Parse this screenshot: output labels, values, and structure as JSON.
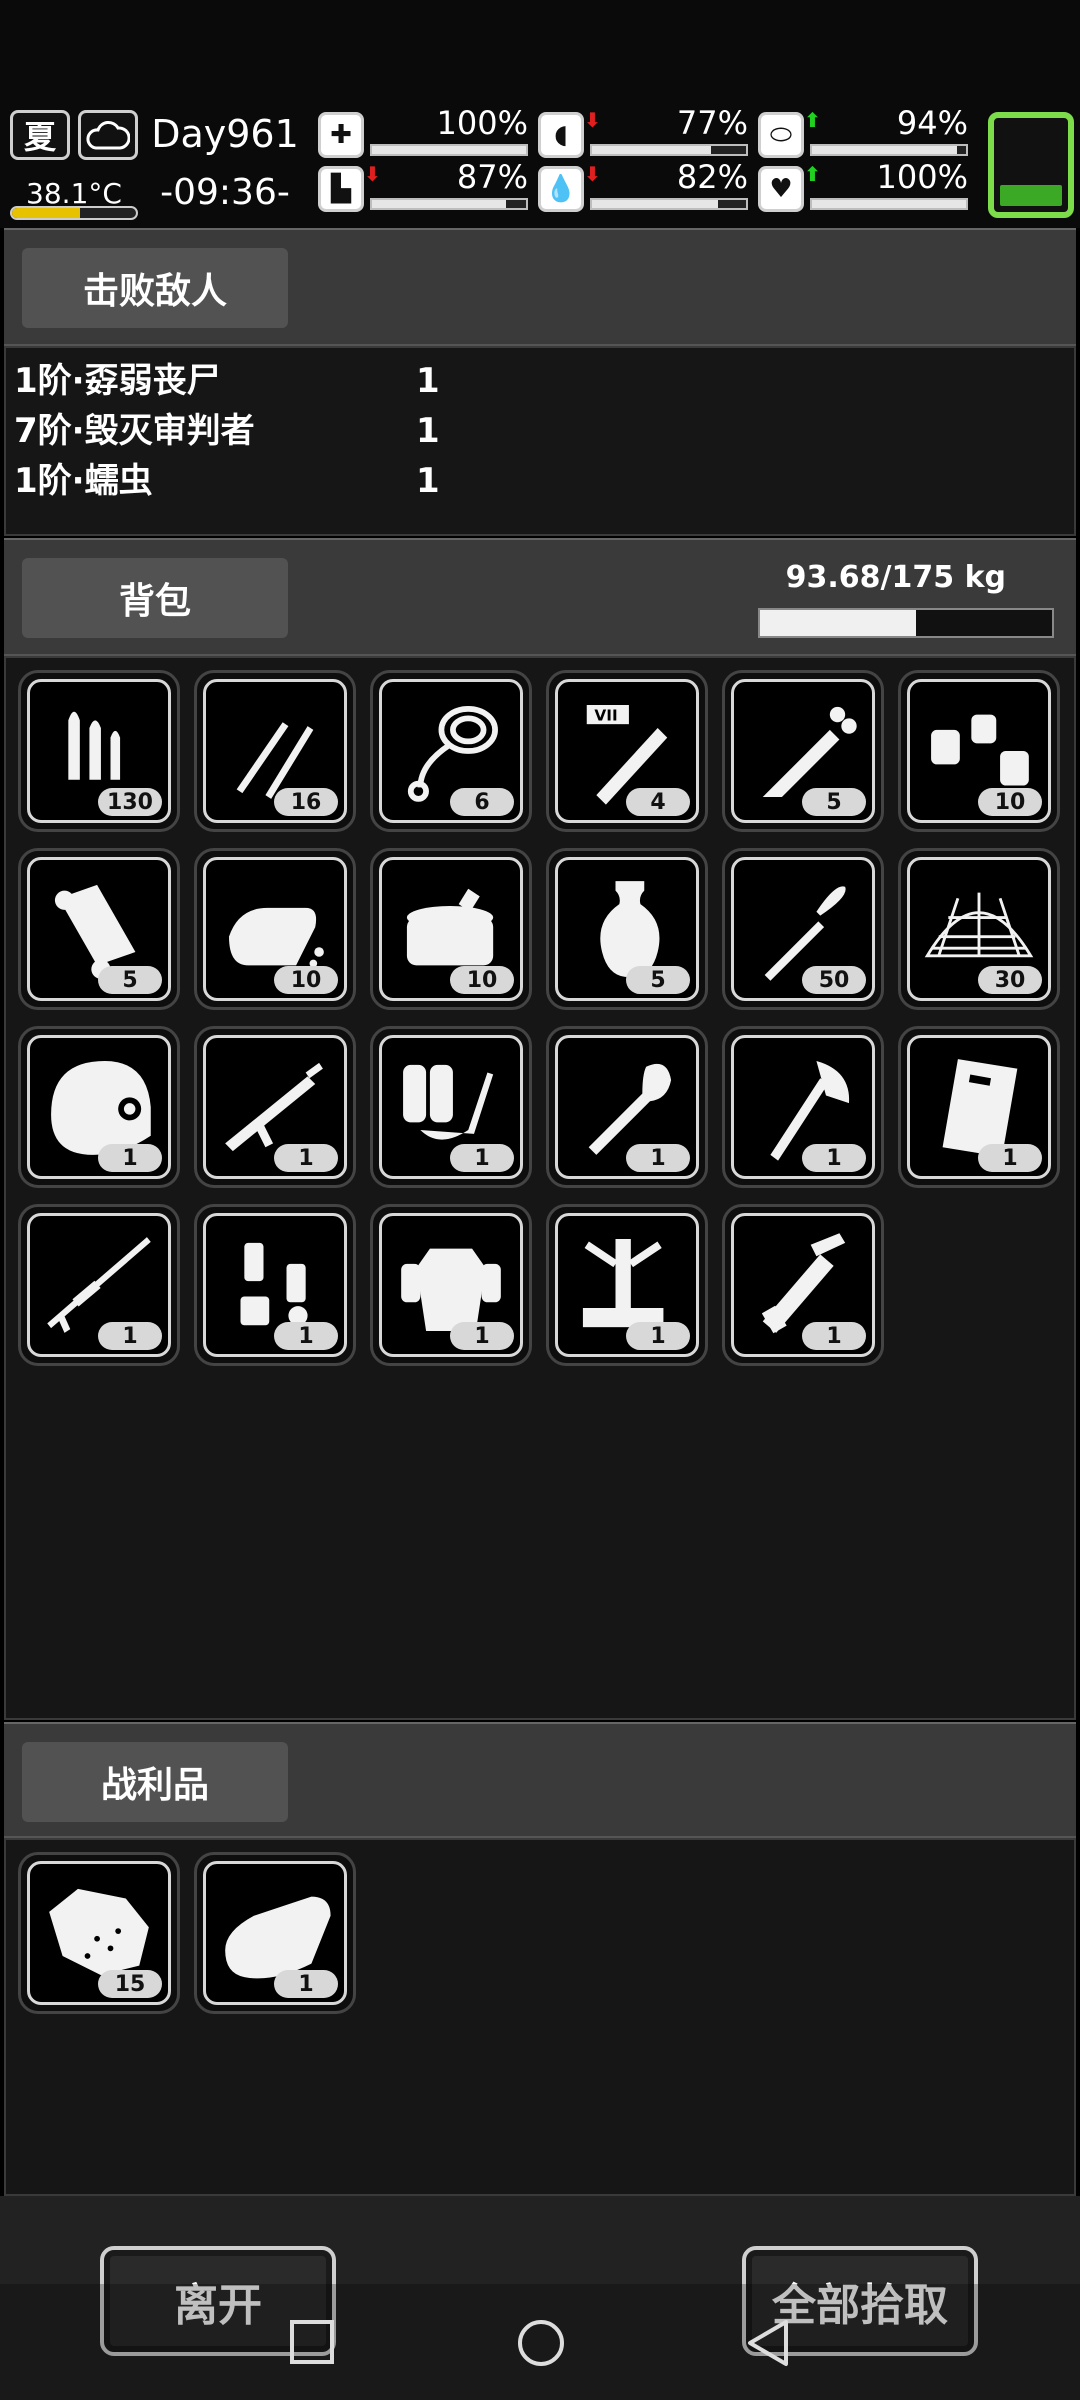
{
  "status": {
    "season": "夏",
    "weather_icon": "cloud-icon",
    "temperature": "38.1°C",
    "temperature_level": 0.55,
    "day": "Day961",
    "time": "-09:36-",
    "stats": [
      {
        "name": "health",
        "icon": "medkit-icon",
        "value": "100%",
        "level": 1.0,
        "arrow": ""
      },
      {
        "name": "hunger",
        "icon": "stomach-icon",
        "value": "77%",
        "level": 0.77,
        "arrow": "down"
      },
      {
        "name": "mental",
        "icon": "pill-icon",
        "value": "94%",
        "level": 0.94,
        "arrow": "up"
      },
      {
        "name": "stamina",
        "icon": "boot-icon",
        "value": "87%",
        "level": 0.87,
        "arrow": "down"
      },
      {
        "name": "thirst",
        "icon": "water-drop-icon",
        "value": "82%",
        "level": 0.82,
        "arrow": "down"
      },
      {
        "name": "mood",
        "icon": "heart-icon",
        "value": "100%",
        "level": 1.0,
        "arrow": "up"
      }
    ],
    "battery_level": 0.35,
    "battery_color": "#3ba826"
  },
  "enemies_section": {
    "title": "击败敌人",
    "rows": [
      {
        "name": "1阶·孬弱丧尸",
        "count": "1"
      },
      {
        "name": "7阶·毁灭审判者",
        "count": "1"
      },
      {
        "name": "1阶·蠕虫",
        "count": "1"
      }
    ]
  },
  "backpack_section": {
    "title": "背包",
    "weight": "93.68/175 kg",
    "weight_level": 0.535,
    "items": [
      {
        "icon": "bullets-icon",
        "count": "130"
      },
      {
        "icon": "rifle-rounds-icon",
        "count": "16"
      },
      {
        "icon": "rope-icon",
        "count": "6"
      },
      {
        "icon": "test-tube-vii-icon",
        "count": "4"
      },
      {
        "icon": "syringe-icon",
        "count": "5"
      },
      {
        "icon": "grenades-icon",
        "count": "10"
      },
      {
        "icon": "cloth-roll-icon",
        "count": "5"
      },
      {
        "icon": "bread-icon",
        "count": "10"
      },
      {
        "icon": "canned-food-icon",
        "count": "10"
      },
      {
        "icon": "vase-icon",
        "count": "5"
      },
      {
        "icon": "rpg-rocket-icon",
        "count": "50"
      },
      {
        "icon": "net-icon",
        "count": "30"
      },
      {
        "icon": "helmet-icon",
        "count": "1"
      },
      {
        "icon": "assault-rifle-icon",
        "count": "1"
      },
      {
        "icon": "flamethrower-icon",
        "count": "1"
      },
      {
        "icon": "shovel-icon",
        "count": "1"
      },
      {
        "icon": "axe-icon",
        "count": "1"
      },
      {
        "icon": "riot-shield-icon",
        "count": "1"
      },
      {
        "icon": "sniper-rifle-icon",
        "count": "1"
      },
      {
        "icon": "mech-parts-icon",
        "count": "1"
      },
      {
        "icon": "power-armor-icon",
        "count": "1"
      },
      {
        "icon": "turret-icon",
        "count": "1"
      },
      {
        "icon": "minigun-icon",
        "count": "1"
      }
    ]
  },
  "loot_section": {
    "title": "战利品",
    "items": [
      {
        "icon": "ore-icon",
        "count": "15"
      },
      {
        "icon": "fabric-icon",
        "count": "1"
      }
    ]
  },
  "actions": {
    "leave": "离开",
    "pick_all": "全部拾取"
  },
  "navbar": {
    "recent_icon": "square-icon",
    "home_icon": "circle-icon",
    "back_icon": "triangle-back-icon"
  }
}
